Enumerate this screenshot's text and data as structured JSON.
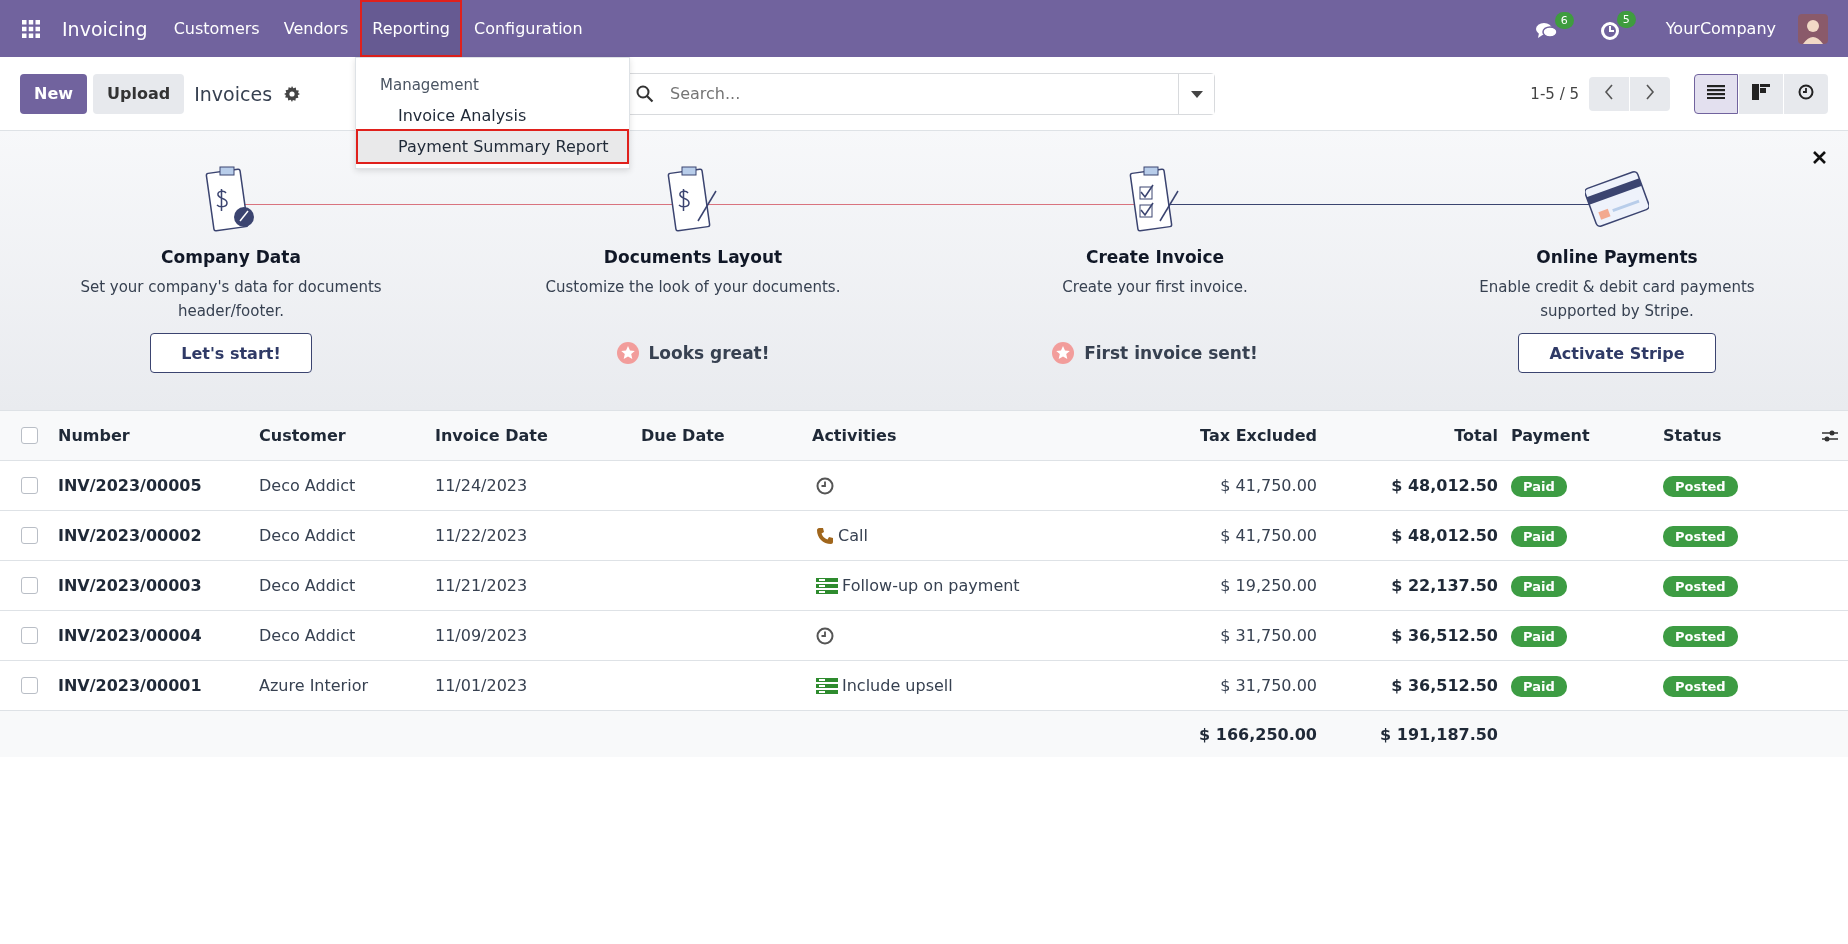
{
  "navbar": {
    "app_name": "Invoicing",
    "menus": [
      {
        "label": "Customers",
        "selected": false,
        "highlighted": false
      },
      {
        "label": "Vendors",
        "selected": false,
        "highlighted": false
      },
      {
        "label": "Reporting",
        "selected": true,
        "highlighted": true
      },
      {
        "label": "Configuration",
        "selected": false,
        "highlighted": false
      }
    ],
    "messages_count": "6",
    "activities_count": "5",
    "company": "YourCompany"
  },
  "dropdown": {
    "section": "Management",
    "items": [
      {
        "label": "Invoice Analysis",
        "hovered": false,
        "highlighted": false
      },
      {
        "label": "Payment Summary Report",
        "hovered": true,
        "highlighted": true
      }
    ]
  },
  "control_panel": {
    "buttons": [
      "New",
      "Upload"
    ],
    "breadcrumb": "Invoices",
    "search": {
      "placeholder": "Search..."
    },
    "pager": "1-5 / 5",
    "views": [
      {
        "kind": "list",
        "selected": true
      },
      {
        "kind": "kanban",
        "selected": false
      },
      {
        "kind": "activity",
        "selected": false
      }
    ]
  },
  "onboarding": {
    "steps": [
      {
        "kind": "company",
        "title": "Company Data",
        "description": "Set your company's data for documents header/footer.",
        "done": false,
        "action": "Let's start!"
      },
      {
        "kind": "layout",
        "title": "Documents Layout",
        "description": "Customize the look of your documents.",
        "done": true,
        "action": "Looks great!"
      },
      {
        "kind": "invoice",
        "title": "Create Invoice",
        "description": "Create your first invoice.",
        "done": true,
        "action": "First invoice sent!"
      },
      {
        "kind": "payment",
        "title": "Online Payments",
        "description": "Enable credit & debit card payments supported by Stripe.",
        "done": false,
        "action": "Activate Stripe"
      }
    ]
  },
  "table": {
    "all_checked": false,
    "columns": [
      "Number",
      "Customer",
      "Invoice Date",
      "Due Date",
      "Activities",
      "Tax Excluded",
      "Total",
      "Payment",
      "Status"
    ],
    "rows": [
      {
        "checked": false,
        "number": "INV/2023/00005",
        "customer": "Deco Addict",
        "invoice_date": "11/24/2023",
        "activity": {
          "kind": "clock"
        },
        "tax_excluded": "$ 41,750.00",
        "total": "$ 48,012.50",
        "payment": "Paid",
        "status": "Posted"
      },
      {
        "checked": false,
        "number": "INV/2023/00002",
        "customer": "Deco Addict",
        "invoice_date": "11/22/2023",
        "activity": {
          "kind": "call",
          "label": "Call"
        },
        "tax_excluded": "$ 41,750.00",
        "total": "$ 48,012.50",
        "payment": "Paid",
        "status": "Posted"
      },
      {
        "checked": false,
        "number": "INV/2023/00003",
        "customer": "Deco Addict",
        "invoice_date": "11/21/2023",
        "activity": {
          "kind": "todo",
          "label": "Follow-up on payment"
        },
        "tax_excluded": "$ 19,250.00",
        "total": "$ 22,137.50",
        "payment": "Paid",
        "status": "Posted"
      },
      {
        "checked": false,
        "number": "INV/2023/00004",
        "customer": "Deco Addict",
        "invoice_date": "11/09/2023",
        "activity": {
          "kind": "clock"
        },
        "tax_excluded": "$ 31,750.00",
        "total": "$ 36,512.50",
        "payment": "Paid",
        "status": "Posted"
      },
      {
        "checked": false,
        "number": "INV/2023/00001",
        "customer": "Azure Interior",
        "invoice_date": "11/01/2023",
        "activity": {
          "kind": "todo",
          "label": "Include upsell"
        },
        "tax_excluded": "$ 31,750.00",
        "total": "$ 36,512.50",
        "payment": "Paid",
        "status": "Posted"
      }
    ],
    "totals": {
      "tax_excluded": "$ 166,250.00",
      "total": "$ 191,187.50"
    }
  }
}
